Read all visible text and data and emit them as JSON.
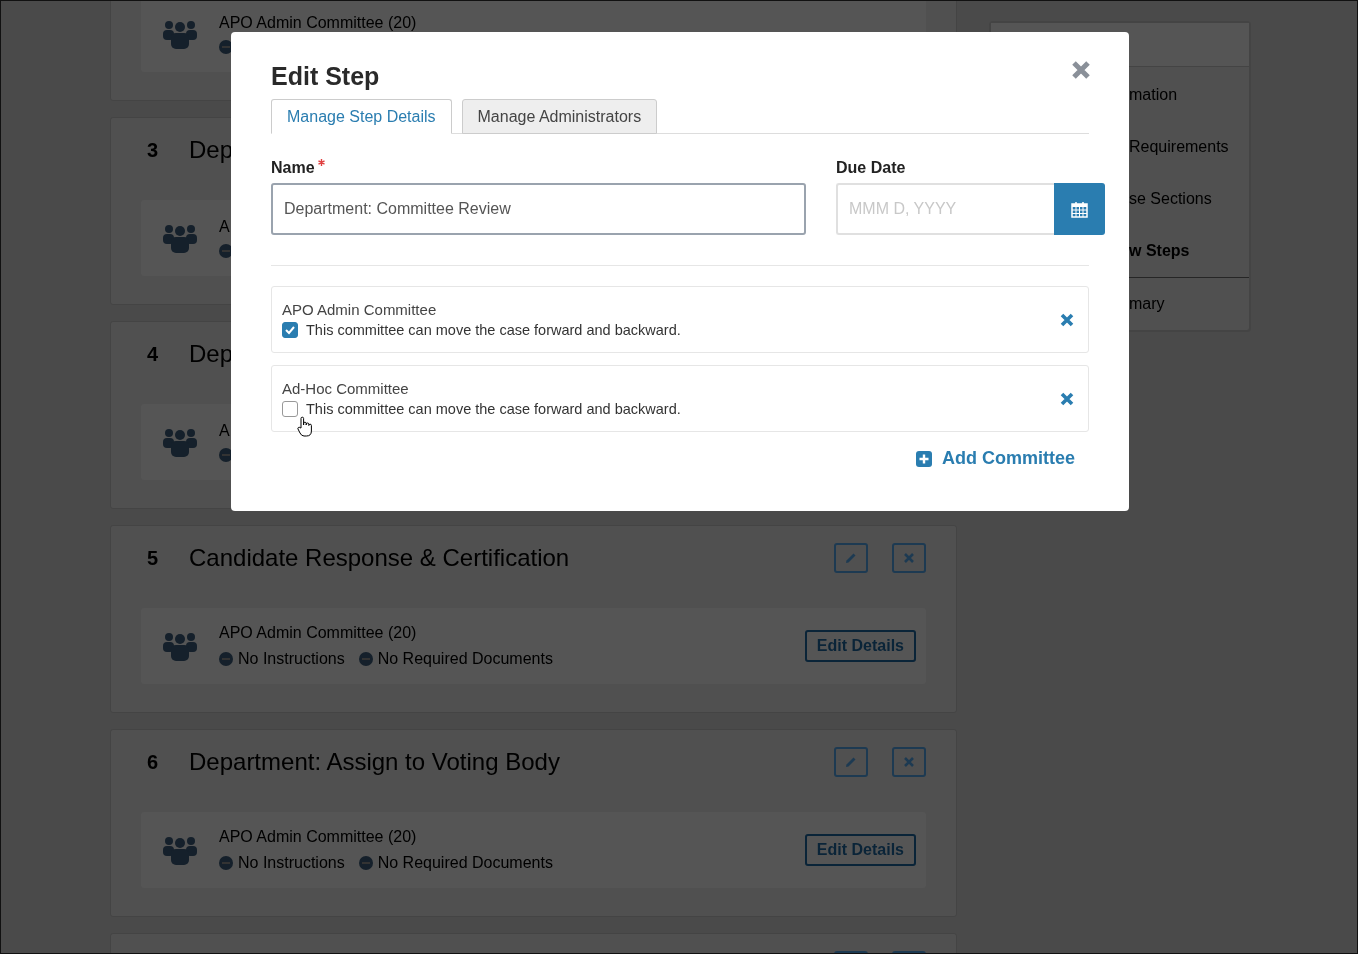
{
  "background_page": {
    "steps": [
      {
        "kind": "tail",
        "committees": [
          {
            "name": "APO Admin Committee (20)"
          }
        ]
      },
      {
        "kind": "full",
        "number": "3",
        "title": "Dep",
        "actions": false,
        "committees": [
          {
            "name": "A"
          }
        ]
      },
      {
        "kind": "full",
        "number": "4",
        "title": "Dep",
        "actions": false,
        "committees": [
          {
            "name": "A"
          }
        ]
      },
      {
        "kind": "full",
        "number": "5",
        "title": "Candidate Response & Certification",
        "actions": true,
        "committees": [
          {
            "name": "APO Admin Committee (20)",
            "tags": [
              "No Instructions",
              "No Required Documents"
            ],
            "button": "Edit Details"
          }
        ]
      },
      {
        "kind": "full",
        "number": "6",
        "title": "Department: Assign to Voting Body",
        "actions": true,
        "committees": [
          {
            "name": "APO Admin Committee (20)",
            "tags": [
              "No Instructions",
              "No Required Documents"
            ],
            "button": "Edit Details"
          }
        ]
      },
      {
        "kind": "head",
        "actions": true
      }
    ],
    "sidebar": {
      "items": [
        {
          "label": "mation",
          "selected": false
        },
        {
          "label": "Requirements",
          "selected": false
        },
        {
          "label": "se Sections",
          "selected": false
        },
        {
          "label": "w Steps",
          "selected": true
        },
        {
          "label": "mary",
          "selected": false
        }
      ]
    }
  },
  "modal": {
    "title": "Edit Step",
    "tabs": [
      {
        "label": "Manage Step Details",
        "selected": true
      },
      {
        "label": "Manage Administrators",
        "selected": false
      }
    ],
    "name_field": {
      "label": "Name",
      "required": true,
      "value": "Department: Committee Review"
    },
    "due_date_field": {
      "label": "Due Date",
      "placeholder": "MMM D, YYYY"
    },
    "committees": [
      {
        "name": "APO Admin Committee",
        "checked": true,
        "option": "This committee can move the case forward and backward."
      },
      {
        "name": "Ad-Hoc Committee",
        "checked": false,
        "option": "This committee can move the case forward and backward."
      }
    ],
    "add_button": "Add Committee"
  }
}
